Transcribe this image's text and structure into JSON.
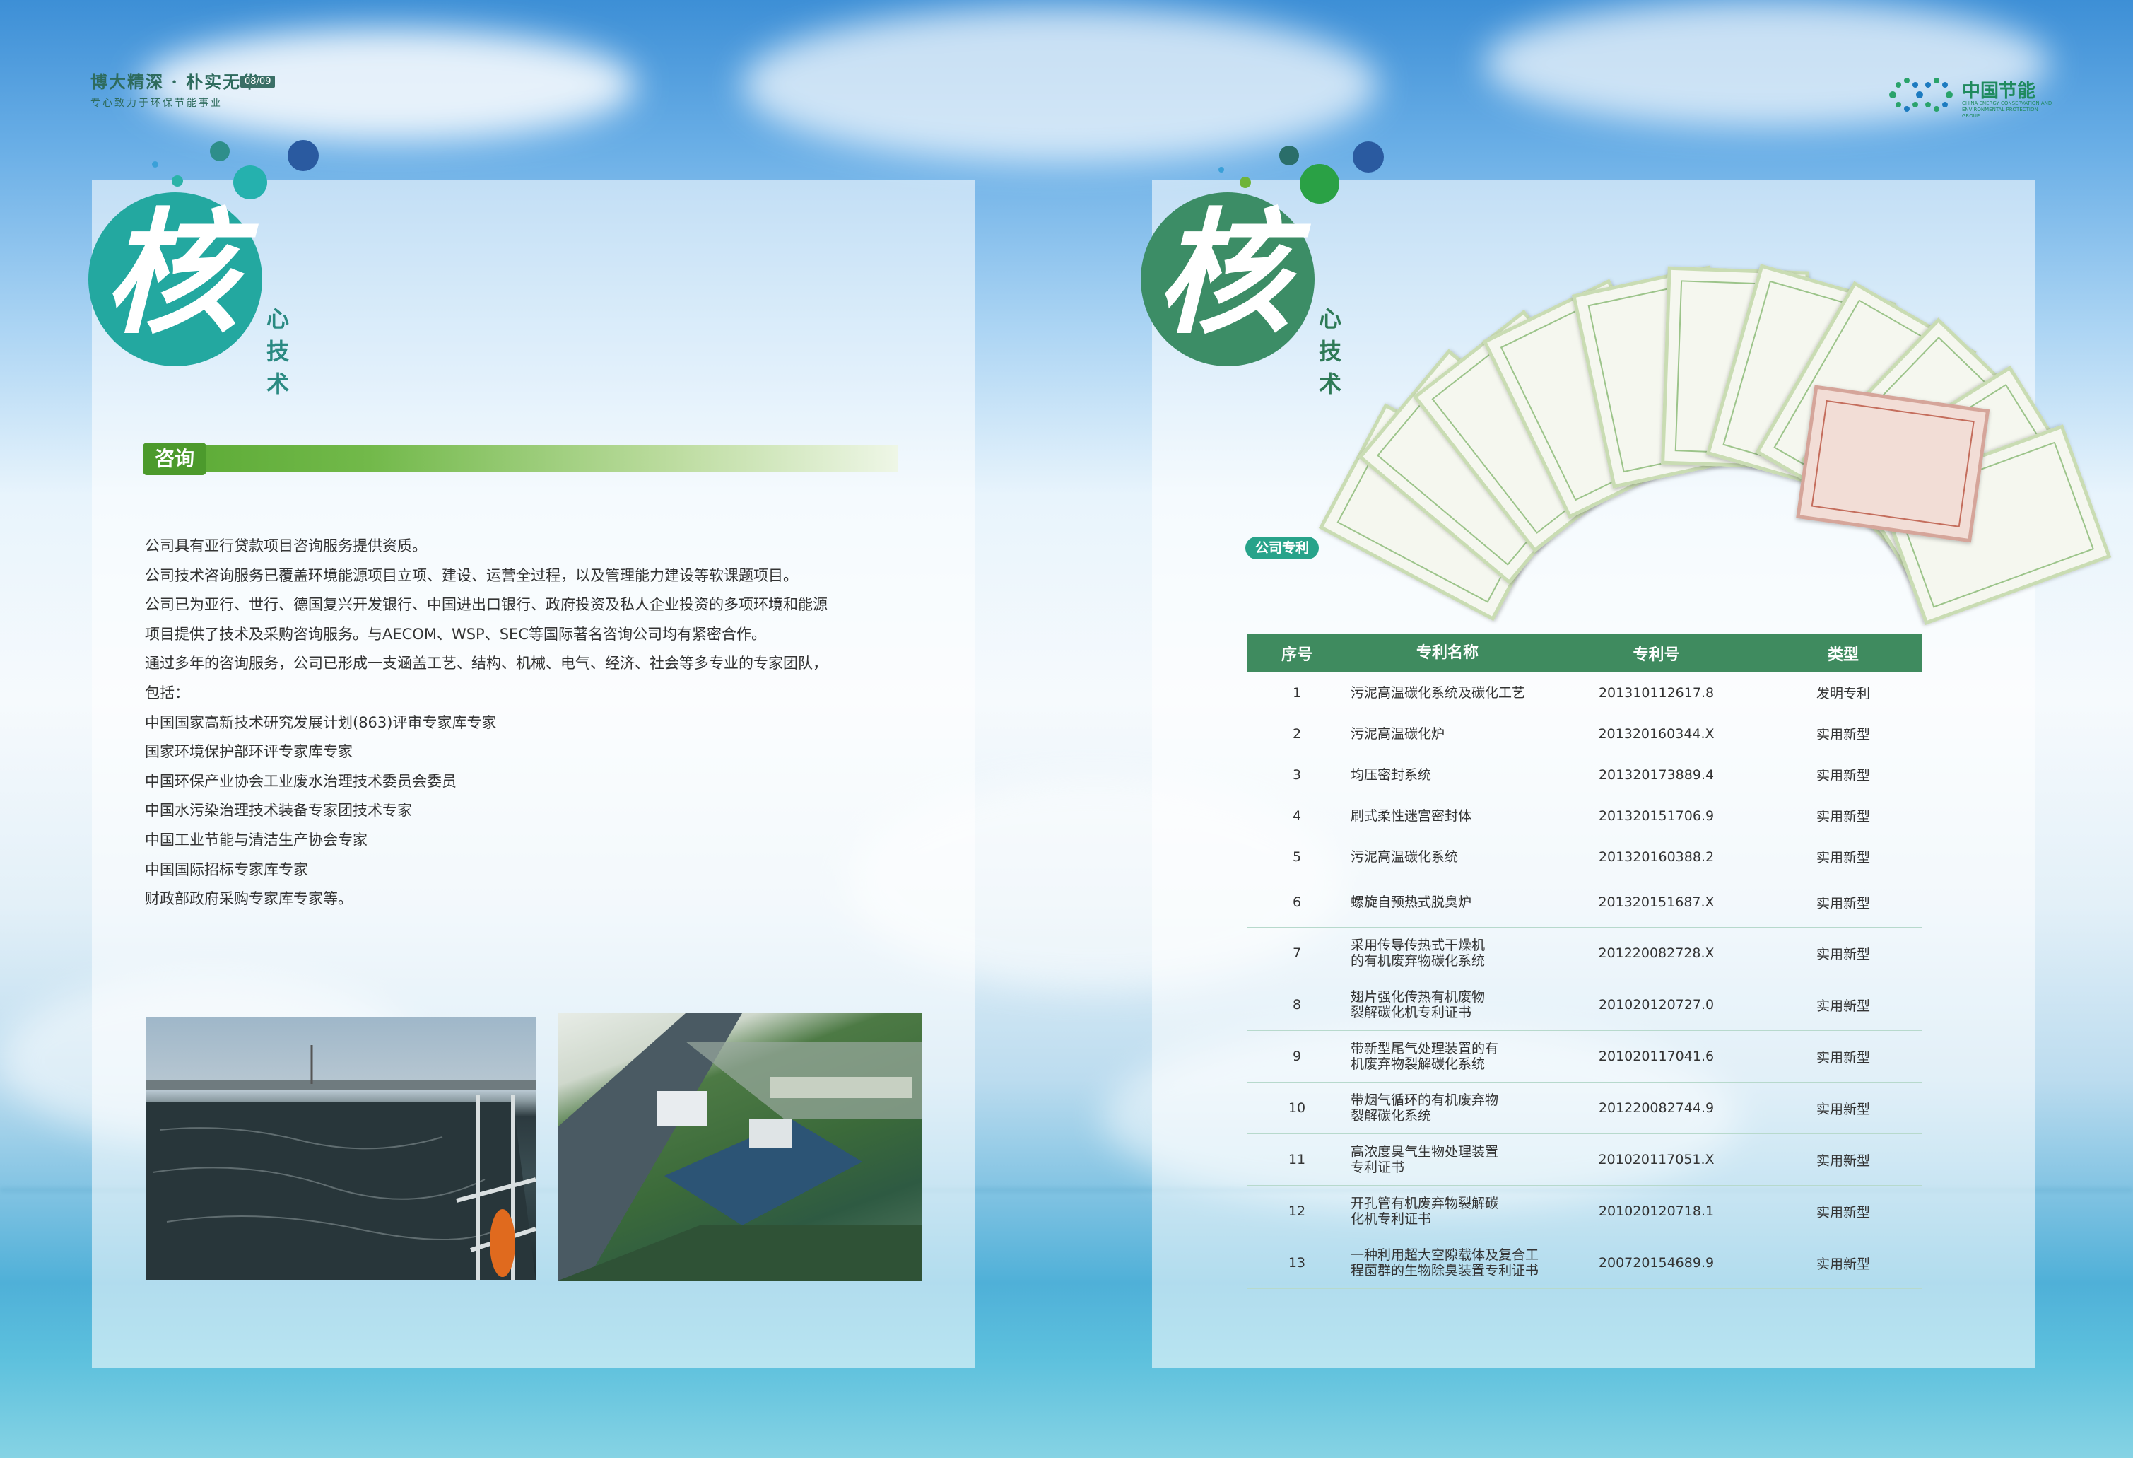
{
  "header": {
    "slogan_main": "博大精深 · 朴实无华",
    "slogan_sub": "专心致力于环保节能事业",
    "page_number": "08/09"
  },
  "logo": {
    "name_cn": "中国节能",
    "name_en": "CHINA ENERGY CONSERVATION AND ENVIRONMENTAL PROTECTION GROUP"
  },
  "left_page": {
    "title_char": "核",
    "title_rest": "心技术",
    "section_label": "咨询",
    "paragraphs": [
      "公司具有亚行贷款项目咨询服务提供资质。",
      "公司技术咨询服务已覆盖环境能源项目立项、建设、运营全过程，以及管理能力建设等软课题项目。",
      "公司已为亚行、世行、德国复兴开发银行、中国进出口银行、政府投资及私人企业投资的多项环境和能源",
      "项目提供了技术及采购咨询服务。与AECOM、WSP、SEC等国际著名咨询公司均有紧密合作。",
      "通过多年的咨询服务，公司已形成一支涵盖工艺、结构、机械、电气、经济、社会等多专业的专家团队，",
      "包括：",
      "中国国家高新技术研究发展计划(863)评审专家库专家",
      "国家环境保护部环评专家库专家",
      "中国环保产业协会工业废水治理技术委员会委员",
      "中国水污染治理技术装备专家团技术专家",
      "中国工业节能与清洁生产协会专家",
      "中国国际招标专家库专家",
      "财政部政府采购专家库专家等。"
    ]
  },
  "right_page": {
    "title_char": "核",
    "title_rest": "心技术",
    "patent_tag": "公司专利",
    "table": {
      "headers": [
        "序号",
        "专利名称",
        "专利号",
        "类型"
      ],
      "rows": [
        {
          "no": "1",
          "name_line1": "污泥高温碳化系统及碳化工艺",
          "name_line2": "",
          "number": "201310112617.8",
          "type": "发明专利"
        },
        {
          "no": "2",
          "name_line1": "污泥高温碳化炉",
          "name_line2": "",
          "number": "201320160344.X",
          "type": "实用新型"
        },
        {
          "no": "3",
          "name_line1": "均压密封系统",
          "name_line2": "",
          "number": "201320173889.4",
          "type": "实用新型"
        },
        {
          "no": "4",
          "name_line1": "刷式柔性迷宫密封体",
          "name_line2": "",
          "number": "201320151706.9",
          "type": "实用新型"
        },
        {
          "no": "5",
          "name_line1": "污泥高温碳化系统",
          "name_line2": "",
          "number": "201320160388.2",
          "type": "实用新型"
        },
        {
          "no": "6",
          "name_line1": "螺旋自预热式脱臭炉",
          "name_line2": "",
          "number": "201320151687.X",
          "type": "实用新型"
        },
        {
          "no": "7",
          "name_line1": "采用传导传热式干燥机",
          "name_line2": "的有机废弃物碳化系统",
          "number": "201220082728.X",
          "type": "实用新型"
        },
        {
          "no": "8",
          "name_line1": "翅片强化传热有机废物",
          "name_line2": "裂解碳化机专利证书",
          "number": "201020120727.0",
          "type": "实用新型"
        },
        {
          "no": "9",
          "name_line1": "带新型尾气处理装置的有",
          "name_line2": "机废弃物裂解碳化系统",
          "number": "201020117041.6",
          "type": "实用新型"
        },
        {
          "no": "10",
          "name_line1": "带烟气循环的有机废弃物",
          "name_line2": "裂解碳化系统",
          "number": "201220082744.9",
          "type": "实用新型"
        },
        {
          "no": "11",
          "name_line1": "高浓度臭气生物处理装置",
          "name_line2": "专利证书",
          "number": "201020117051.X",
          "type": "实用新型"
        },
        {
          "no": "12",
          "name_line1": "开孔管有机废弃物裂解碳",
          "name_line2": "化机专利证书",
          "number": "201020120718.1",
          "type": "实用新型"
        },
        {
          "no": "13",
          "name_line1": "一种利用超大空隙载体及复合工",
          "name_line2": "程菌群的生物除臭装置专利证书",
          "number": "200720154689.9",
          "type": "实用新型"
        }
      ]
    }
  },
  "colors": {
    "left_emblem": "#23a8a0",
    "right_emblem": "#3c8d66",
    "table_header": "#3f8b5f",
    "section_green": "#4c9a2c"
  }
}
